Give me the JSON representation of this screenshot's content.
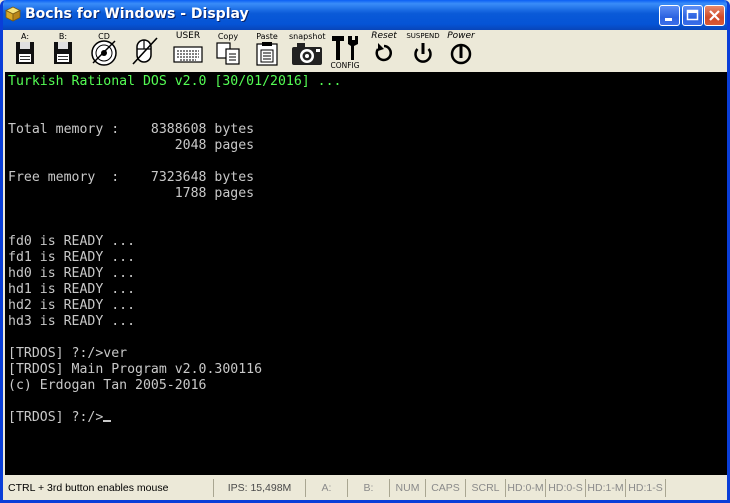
{
  "window": {
    "title": "Bochs for Windows - Display"
  },
  "toolbar": {
    "floppy_a": "A:",
    "floppy_b": "B:",
    "cdrom": "CD",
    "user": "USER",
    "copy": "Copy",
    "paste": "Paste",
    "snapshot": "snapshot",
    "config": "CONFIG",
    "reset": "Reset",
    "suspend": "SUSPEND",
    "power": "Power"
  },
  "console": {
    "lines": [
      "Turkish Rational DOS v2.0 [30/01/2016] ...",
      "",
      "",
      "Total memory :    8388608 bytes",
      "                     2048 pages",
      "",
      "Free memory  :    7323648 bytes",
      "                     1788 pages",
      "",
      "",
      "fd0 is READY ...",
      "fd1 is READY ...",
      "hd0 is READY ...",
      "hd1 is READY ...",
      "hd2 is READY ...",
      "hd3 is READY ...",
      "",
      "[TRDOS] ?:/>ver",
      "[TRDOS] Main Program v2.0.300116",
      "(c) Erdogan Tan 2005-2016",
      "",
      "[TRDOS] ?:/>"
    ]
  },
  "status": {
    "hint": "CTRL + 3rd button enables mouse",
    "ips": "IPS: 15,498M",
    "a": "A:",
    "b": "B:",
    "num": "NUM",
    "caps": "CAPS",
    "scrl": "SCRL",
    "hd0m": "HD:0-M",
    "hd0s": "HD:0-S",
    "hd1m": "HD:1-M",
    "hd1s": "HD:1-S"
  },
  "colors": {
    "title_bar": "#0a5ad8",
    "console_bg": "#000000",
    "console_text": "#c8c8c8",
    "console_banner": "#54fc54"
  }
}
